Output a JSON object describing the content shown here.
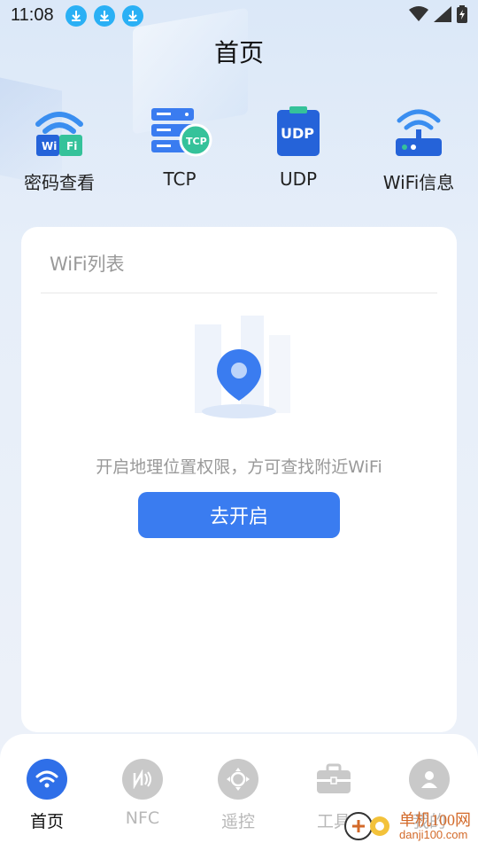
{
  "status_bar": {
    "time": "11:08"
  },
  "header": {
    "title": "首页"
  },
  "quick_actions": [
    {
      "label": "密码查看",
      "icon": "wifi-password-icon"
    },
    {
      "label": "TCP",
      "icon": "tcp-server-icon"
    },
    {
      "label": "UDP",
      "icon": "udp-clipboard-icon"
    },
    {
      "label": "WiFi信息",
      "icon": "router-icon"
    }
  ],
  "wifi_card": {
    "title": "WiFi列表",
    "hint": "开启地理位置权限，方可查找附近WiFi",
    "button_label": "去开启"
  },
  "tabbar": {
    "tabs": [
      {
        "label": "首页",
        "icon": "wifi-icon",
        "active": true
      },
      {
        "label": "NFC",
        "icon": "nfc-icon",
        "active": false
      },
      {
        "label": "遥控",
        "icon": "remote-control-icon",
        "active": false
      },
      {
        "label": "工具",
        "icon": "toolbox-icon",
        "active": false
      },
      {
        "label": "我的",
        "icon": "user-icon",
        "active": false
      }
    ]
  },
  "watermark": {
    "text": "单机100网",
    "url": "danji100.com"
  },
  "colors": {
    "accent": "#3a7cf0",
    "download_icon": "#2ab0f5"
  }
}
